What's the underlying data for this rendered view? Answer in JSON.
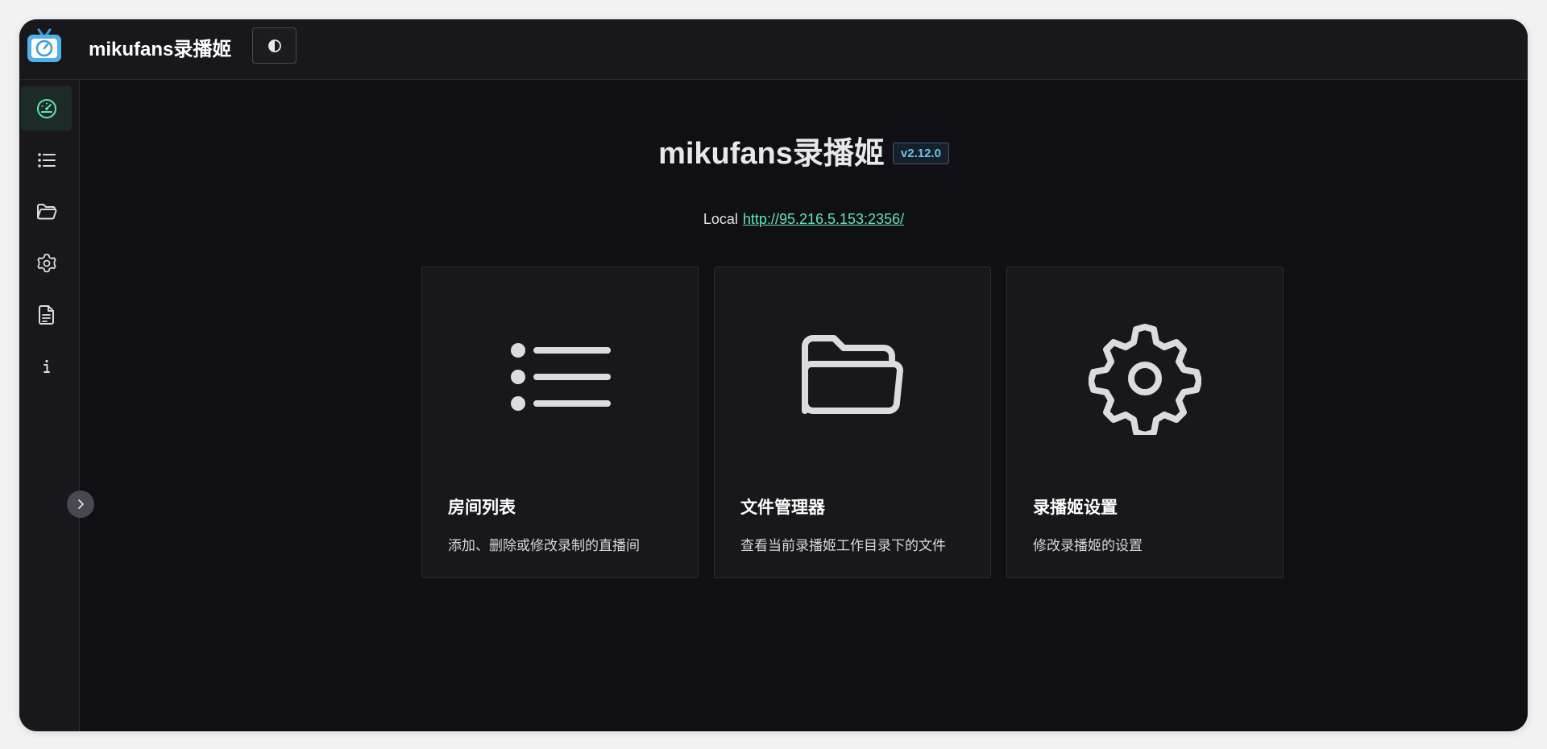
{
  "header": {
    "title": "mikufans录播姬",
    "logo_icon": "tv-logo-icon",
    "theme_toggle_icon": "contrast-icon"
  },
  "sidebar": {
    "items": [
      {
        "id": "dashboard",
        "icon": "dashboard-icon",
        "active": true
      },
      {
        "id": "room-list",
        "icon": "list-icon",
        "active": false
      },
      {
        "id": "files",
        "icon": "folder-icon",
        "active": false
      },
      {
        "id": "settings",
        "icon": "gear-icon",
        "active": false
      },
      {
        "id": "logs",
        "icon": "document-icon",
        "active": false
      },
      {
        "id": "about",
        "icon": "info-icon",
        "active": false
      }
    ],
    "collapse_icon": "chevron-right-icon"
  },
  "main": {
    "title": "mikufans录播姬",
    "version": "v2.12.0",
    "local_label": "Local",
    "local_url": "http://95.216.5.153:2356/",
    "cards": [
      {
        "title": "房间列表",
        "description": "添加、删除或修改录制的直播间",
        "icon": "list-icon"
      },
      {
        "title": "文件管理器",
        "description": "查看当前录播姬工作目录下的文件",
        "icon": "folder-open-icon"
      },
      {
        "title": "录播姬设置",
        "description": "修改录播姬的设置",
        "icon": "gear-icon"
      }
    ]
  },
  "colors": {
    "background": "#101014",
    "panel": "#18181c",
    "accent_green": "#63e2b7",
    "version_blue": "#70c0e8"
  }
}
